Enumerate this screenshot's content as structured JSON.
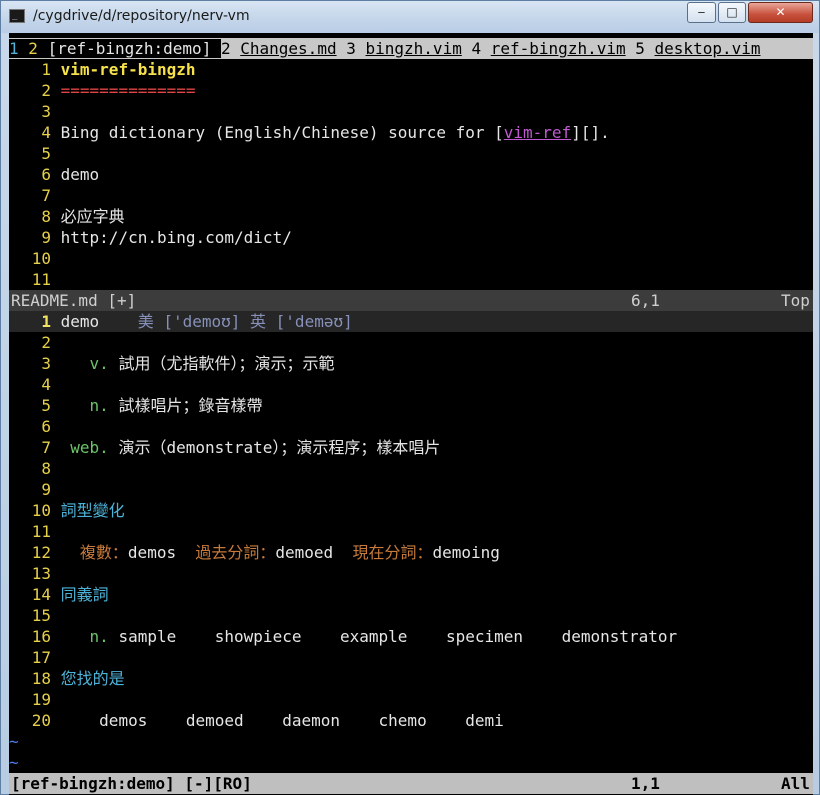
{
  "window": {
    "title": "/cygdrive/d/repository/nerv-vm",
    "icon": "terminal-icon",
    "controls": {
      "minimize": "‒",
      "maximize": "□",
      "close": "✕"
    }
  },
  "tabline": {
    "count": "1",
    "active": {
      "num": "2",
      "label": "[ref-bingzh:demo]"
    },
    "tabs": [
      {
        "num": "2",
        "label": "Changes.md"
      },
      {
        "num": "3",
        "label": "bingzh.vim"
      },
      {
        "num": "4",
        "label": "ref-bingzh.vim"
      },
      {
        "num": "5",
        "label": "desktop.vim"
      }
    ]
  },
  "top_pane": {
    "lines": [
      {
        "n": "1",
        "t": "vim-ref-bingzh"
      },
      {
        "n": "2",
        "t": "=============="
      },
      {
        "n": "3",
        "t": ""
      },
      {
        "n": "4",
        "pre": "Bing dictionary (English/Chinese) source for [",
        "link": "vim-ref",
        "post": "][]."
      },
      {
        "n": "5",
        "t": ""
      },
      {
        "n": "6",
        "t": "demo"
      },
      {
        "n": "7",
        "t": ""
      },
      {
        "n": "8",
        "t": "必应字典"
      },
      {
        "n": "9",
        "t": "http://cn.bing.com/dict/"
      },
      {
        "n": "10",
        "t": ""
      },
      {
        "n": "11",
        "t": ""
      }
    ],
    "status": {
      "file": "README.md [+]",
      "pos": "6,1",
      "pct": "Top"
    }
  },
  "bottom_pane": {
    "line1": {
      "n": "1",
      "word": "demo",
      "pron": "美 ['demoʊ] 英 ['deməʊ]"
    },
    "lines": [
      {
        "n": "2",
        "t": ""
      },
      {
        "n": "3",
        "tag": "v.",
        "t": "試用（尤指軟件）；演示；示範"
      },
      {
        "n": "4",
        "t": ""
      },
      {
        "n": "5",
        "tag": "n.",
        "t": "試樣唱片；錄音樣帶"
      },
      {
        "n": "6",
        "t": ""
      },
      {
        "n": "7",
        "tag": "web.",
        "t": "演示（demonstrate）；演示程序；樣本唱片"
      },
      {
        "n": "8",
        "t": ""
      },
      {
        "n": "9",
        "t": ""
      },
      {
        "n": "10",
        "heading": "詞型變化"
      },
      {
        "n": "11",
        "t": ""
      },
      {
        "n": "12",
        "forms": [
          {
            "k": "複數：",
            "v": "demos"
          },
          {
            "k": "過去分詞：",
            "v": "demoed"
          },
          {
            "k": "現在分詞：",
            "v": "demoing"
          }
        ]
      },
      {
        "n": "13",
        "t": ""
      },
      {
        "n": "14",
        "heading": "同義詞"
      },
      {
        "n": "15",
        "t": ""
      },
      {
        "n": "16",
        "tag": "n.",
        "words": [
          "sample",
          "showpiece",
          "example",
          "specimen",
          "demonstrator"
        ]
      },
      {
        "n": "17",
        "t": ""
      },
      {
        "n": "18",
        "heading": "您找的是"
      },
      {
        "n": "19",
        "t": ""
      },
      {
        "n": "20",
        "suggest": [
          "demos",
          "demoed",
          "daemon",
          "chemo",
          "demi"
        ]
      }
    ],
    "tildes": [
      "~",
      "~"
    ],
    "status": {
      "file": "[ref-bingzh:demo] [-][RO]",
      "pos": "1,1",
      "pct": "All"
    }
  },
  "colors": {
    "background": "#000000",
    "line_number": "#e7d14b",
    "heading": "#4cb3d8",
    "tag": "#6bc46b",
    "link": "#c05ad1"
  }
}
